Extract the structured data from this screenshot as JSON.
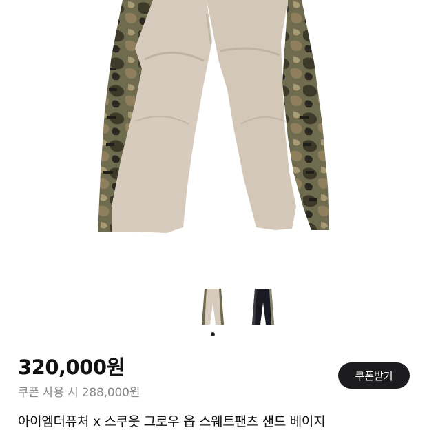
{
  "product": {
    "price": "320,000원",
    "coupon_price": "쿠폰 사용 시 288,000원",
    "coupon_button_label": "쿠폰받기",
    "title": "아이엠더퓨처 x 스쿠웃 그로우 옵 스웨트팬츠 샌드 베이지"
  },
  "gallery": {
    "image_count": 2,
    "selected_index": 0,
    "thumbnails": [
      "sand-beige-pants-thumbnail",
      "black-pants-thumbnail"
    ]
  },
  "colors": {
    "button_bg": "#1c1c1e",
    "price_text": "#111111",
    "muted_text": "#888888",
    "pants_sand": "#d6cbbc",
    "camo_green": "#6b6a4a"
  }
}
